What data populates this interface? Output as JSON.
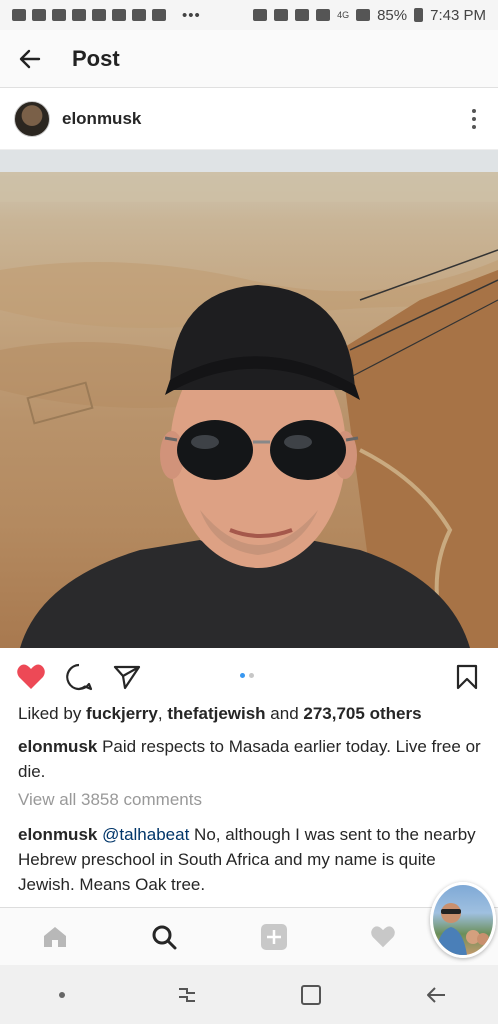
{
  "status_bar": {
    "battery": "85%",
    "time": "7:43 PM",
    "dots": "•••",
    "network": "4G"
  },
  "header": {
    "title": "Post"
  },
  "post": {
    "username": "elonmusk",
    "likes": {
      "prefix": "Liked by ",
      "user1": "fuckjerry",
      "sep": ", ",
      "user2": "thefatjewish",
      "and": " and ",
      "count": "273,705 others"
    },
    "caption": {
      "username": "elonmusk",
      "text": " Paid respects to Masada earlier today. Live free or die."
    },
    "view_comments": "View all 3858 comments",
    "comment": {
      "username": "elonmusk",
      "mention": "@talhabeat",
      "text": " No, although I was sent to the nearby Hebrew preschool in South Africa and my name is quite Jewish. Means Oak tree."
    },
    "truncated_line": "........ ..........  ............. ............ ..."
  },
  "colors": {
    "like_red": "#ed4956",
    "pager_active": "#3897f0",
    "pager_inactive": "#c7c7c7"
  }
}
